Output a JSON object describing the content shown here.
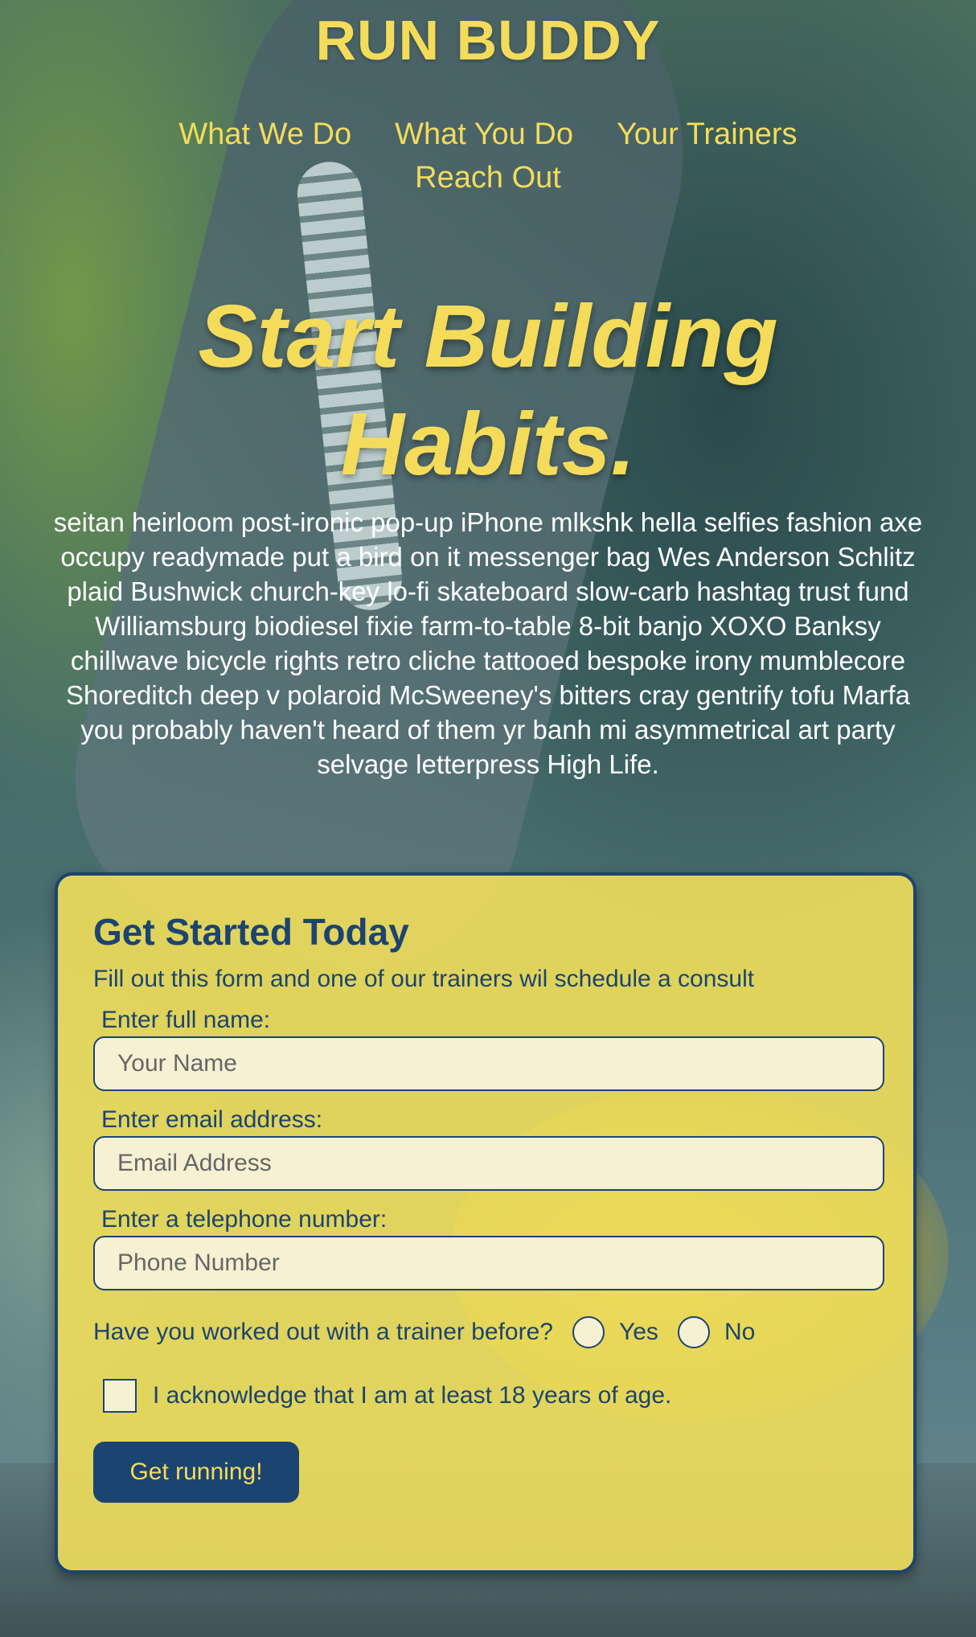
{
  "header": {
    "logo": "RUN BUDDY",
    "nav": [
      "What We Do",
      "What You Do",
      "Your Trainers",
      "Reach Out"
    ]
  },
  "hero": {
    "title": "Start Building Habits.",
    "body": "seitan heirloom post-ironic pop-up iPhone mlkshk hella selfies fashion axe occupy readymade put a bird on it messenger bag Wes Anderson Schlitz plaid Bushwick church-key lo-fi skateboard slow-carb hashtag trust fund Williamsburg biodiesel fixie farm-to-table 8-bit banjo XOXO Banksy chillwave bicycle rights retro cliche tattooed bespoke irony mumblecore Shoreditch deep v polaroid McSweeney's bitters cray gentrify tofu Marfa you probably haven't heard of them yr banh mi asymmetrical art party selvage letterpress High Life."
  },
  "form": {
    "title": "Get Started Today",
    "subtitle": "Fill out this form and one of our trainers wil schedule a consult",
    "name_label": "Enter full name:",
    "name_placeholder": "Your Name",
    "email_label": "Enter email address:",
    "email_placeholder": "Email Address",
    "phone_label": "Enter a telephone number:",
    "phone_placeholder": "Phone Number",
    "trainer_question": "Have you worked out with a trainer before?",
    "yes_label": "Yes",
    "no_label": "No",
    "age_ack": "I acknowledge that I am at least 18 years of age.",
    "submit_label": "Get running!"
  },
  "colors": {
    "accent_yellow": "#f4dc5a",
    "navy": "#1c4470",
    "card_bg": "#f0de5a"
  }
}
